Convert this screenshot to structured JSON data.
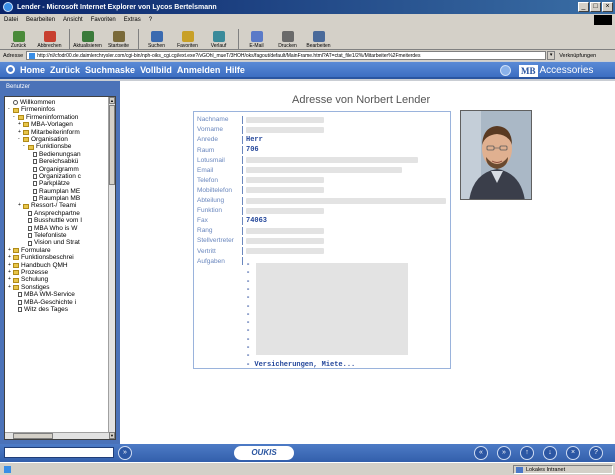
{
  "window": {
    "title": "Lender - Microsoft Internet Explorer von Lycos Bertelsmann"
  },
  "menu": [
    "Datei",
    "Bearbeiten",
    "Ansicht",
    "Favoriten",
    "Extras",
    "?"
  ],
  "toolbar": [
    {
      "label": "Zurück",
      "color": "#4a8a3a"
    },
    {
      "label": "Abbrechen",
      "color": "#c84030"
    },
    {
      "label": "Aktualisieren",
      "color": "#3a7a3a"
    },
    {
      "label": "Startseite",
      "color": "#7a6a3a"
    },
    {
      "label": "Suchen",
      "color": "#3a6ab0"
    },
    {
      "label": "Favoriten",
      "color": "#c8a028"
    },
    {
      "label": "Verlauf",
      "color": "#3a8a9a"
    },
    {
      "label": "E-Mail",
      "color": "#5a7ac8"
    },
    {
      "label": "Drucken",
      "color": "#6a6a6a"
    },
    {
      "label": "Bearbeiten",
      "color": "#4a6a9a"
    }
  ],
  "address": {
    "label": "Adresse",
    "url": "http://nl/cfodr00.de.daimlerchrysler.com/cgi-bin/nph-oiks_cgi.cgi/ext.exe?/vGOhl_mueT/3HOH/oks/fagout/default/MainFrame.html?AT=ctat_file1/2%/Mitarbeiter%2Fmeiterdes",
    "links_label": "Verknüpfungen"
  },
  "nav": [
    "Home",
    "Zurück",
    "Suchmaske",
    "Vollbild",
    "Anmelden",
    "Hilfe"
  ],
  "brand": {
    "mb": "MB",
    "accessories": "Accessories"
  },
  "sidebar": {
    "title": "Benutzer",
    "tree": [
      {
        "label": "Willkommen",
        "indent": 0,
        "icon": "circ",
        "pm": ""
      },
      {
        "label": "Firmeninfos",
        "indent": 0,
        "icon": "fold",
        "pm": "-"
      },
      {
        "label": "Firmeninformation",
        "indent": 1,
        "icon": "fold",
        "pm": "-"
      },
      {
        "label": "MBA-Vorlagen",
        "indent": 2,
        "icon": "fold",
        "pm": "+"
      },
      {
        "label": "Mitarbeiterinform",
        "indent": 2,
        "icon": "fold",
        "pm": "+"
      },
      {
        "label": "Organisation",
        "indent": 2,
        "icon": "fold",
        "pm": "-"
      },
      {
        "label": "Funktionsbe",
        "indent": 3,
        "icon": "fold",
        "pm": "-"
      },
      {
        "label": "Bedienungsan",
        "indent": 4,
        "icon": "doc",
        "pm": ""
      },
      {
        "label": "Bereichsabkü",
        "indent": 4,
        "icon": "doc",
        "pm": ""
      },
      {
        "label": "Organigramm",
        "indent": 4,
        "icon": "doc",
        "pm": ""
      },
      {
        "label": "Organization c",
        "indent": 4,
        "icon": "doc",
        "pm": ""
      },
      {
        "label": "Parkplätze",
        "indent": 4,
        "icon": "doc",
        "pm": ""
      },
      {
        "label": "Raumplan ME",
        "indent": 4,
        "icon": "doc",
        "pm": ""
      },
      {
        "label": "Raumplan MB",
        "indent": 4,
        "icon": "doc",
        "pm": ""
      },
      {
        "label": "Ressort-/ Teami",
        "indent": 2,
        "icon": "fold",
        "pm": "+"
      },
      {
        "label": "Ansprechpartne",
        "indent": 3,
        "icon": "doc",
        "pm": ""
      },
      {
        "label": "Busshuttle vom I",
        "indent": 3,
        "icon": "doc",
        "pm": ""
      },
      {
        "label": "MBA Who is W",
        "indent": 3,
        "icon": "doc",
        "pm": ""
      },
      {
        "label": "Telefonliste",
        "indent": 3,
        "icon": "doc",
        "pm": ""
      },
      {
        "label": "Vision und Strat",
        "indent": 3,
        "icon": "doc",
        "pm": ""
      },
      {
        "label": "Formulare",
        "indent": 0,
        "icon": "fold",
        "pm": "+"
      },
      {
        "label": "Funktionsbeschrei",
        "indent": 0,
        "icon": "fold",
        "pm": "+"
      },
      {
        "label": "Handbuch QMH",
        "indent": 0,
        "icon": "fold",
        "pm": "+"
      },
      {
        "label": "Prozesse",
        "indent": 0,
        "icon": "fold",
        "pm": "+"
      },
      {
        "label": "Schulung",
        "indent": 0,
        "icon": "fold",
        "pm": "+"
      },
      {
        "label": "Sonstiges",
        "indent": 0,
        "icon": "fold",
        "pm": "+"
      },
      {
        "label": "MBA WM-Service",
        "indent": 1,
        "icon": "doc",
        "pm": ""
      },
      {
        "label": "MBA-Geschichte i",
        "indent": 1,
        "icon": "doc",
        "pm": ""
      },
      {
        "label": "Witz des Tages",
        "indent": 1,
        "icon": "doc",
        "pm": ""
      }
    ]
  },
  "main": {
    "title": "Adresse von Norbert Lender",
    "fields": [
      {
        "label": "Nachname",
        "value": "",
        "blur": 78
      },
      {
        "label": "Vorname",
        "value": "",
        "blur": 78
      },
      {
        "label": "Anrede",
        "value": "Herr",
        "blur": 0
      },
      {
        "label": "Raum",
        "value": "706",
        "blur": 0
      },
      {
        "label": "Lotusmail",
        "value": "",
        "blur": 172
      },
      {
        "label": "Email",
        "value": "",
        "blur": 156
      },
      {
        "label": "Telefon",
        "value": "",
        "blur": 78
      },
      {
        "label": "Mobiltelefon",
        "value": "",
        "blur": 78
      },
      {
        "label": "Abteilung",
        "value": "",
        "blur": 200
      },
      {
        "label": "Funktion",
        "value": "",
        "blur": 78
      },
      {
        "label": "Fax",
        "value": "74063",
        "blur": 0
      },
      {
        "label": "Rang",
        "value": "",
        "blur": 78
      },
      {
        "label": "Stellvertreter",
        "value": "",
        "blur": 78
      },
      {
        "label": "Vertritt",
        "value": "",
        "blur": 78
      },
      {
        "label": "Aufgaben",
        "value": "",
        "blur": 0
      }
    ],
    "aufgaben_dashes": 12,
    "aufgaben_last": "- Versicherungen, Miete..."
  },
  "bottom": {
    "go_label": "»",
    "brand": "OUKIS",
    "buttons": [
      "«",
      "»",
      "↑",
      "↓",
      "×",
      "?"
    ]
  },
  "status": {
    "zone": "Lokales Intranet"
  }
}
